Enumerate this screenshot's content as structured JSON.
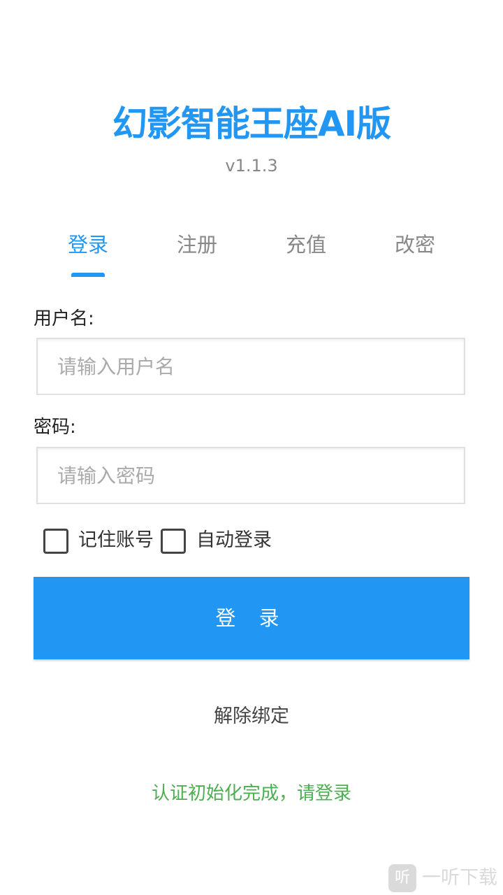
{
  "app": {
    "title": "幻影智能王座AI版",
    "version": "v1.1.3"
  },
  "tabs": [
    {
      "label": "登录",
      "active": true
    },
    {
      "label": "注册",
      "active": false
    },
    {
      "label": "充值",
      "active": false
    },
    {
      "label": "改密",
      "active": false
    }
  ],
  "form": {
    "username_label": "用户名:",
    "username_placeholder": "请输入用户名",
    "username_value": "",
    "password_label": "密码:",
    "password_placeholder": "请输入密码",
    "password_value": "",
    "remember_label": "记住账号",
    "remember_checked": false,
    "autologin_label": "自动登录",
    "autologin_checked": false,
    "login_button": "登 录",
    "unbind_link": "解除绑定"
  },
  "status": {
    "message": "认证初始化完成，请登录"
  },
  "watermark": {
    "icon_glyph": "听",
    "text": "一听下载"
  },
  "colors": {
    "accent": "#2196F3",
    "success": "#4CAF50",
    "muted": "#888888"
  }
}
